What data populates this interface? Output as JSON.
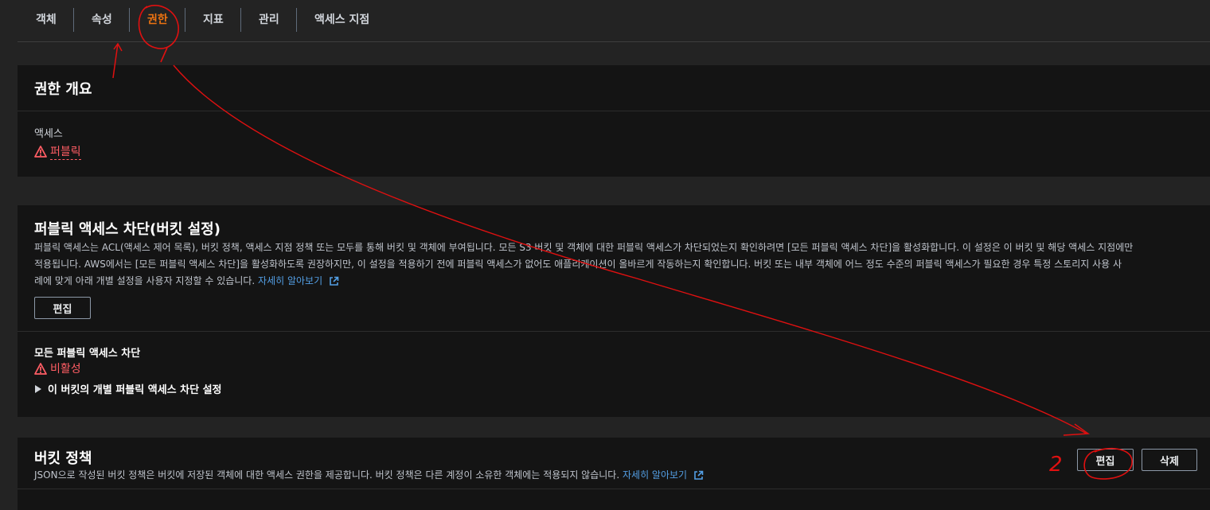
{
  "tabs": [
    {
      "label": "객체"
    },
    {
      "label": "속성"
    },
    {
      "label": "권한"
    },
    {
      "label": "지표"
    },
    {
      "label": "관리"
    },
    {
      "label": "액세스 지점"
    }
  ],
  "permissions_overview": {
    "title": "권한 개요",
    "access_label": "액세스",
    "access_value": "퍼블릭"
  },
  "block_public_access": {
    "title": "퍼블릭 액세스 차단(버킷 설정)",
    "description_line1": "퍼블릭 액세스는 ACL(액세스 제어 목록), 버킷 정책, 액세스 지점 정책 또는 모두를 통해 버킷 및 객체에 부여됩니다. 모든 S3 버킷 및 객체에 대한 퍼블릭 액세스가 차단되었는지 확인하려면 [모든 퍼블릭 액세스 차단]을 활성화합니다. 이 설정은 이 버킷 및 해당 액세스 지점에만",
    "description_line2": "적용됩니다. AWS에서는 [모든 퍼블릭 액세스 차단]을 활성화하도록 권장하지만, 이 설정을 적용하기 전에 퍼블릭 액세스가 없어도 애플리케이션이 올바르게 작동하는지 확인합니다. 버킷 또는 내부 객체에 어느 정도 수준의 퍼블릭 액세스가 필요한 경우 특정 스토리지 사용 사",
    "description_line3": "례에 맞게 아래 개별 설정을 사용자 지정할 수 있습니다.",
    "learn_more": "자세히 알아보기",
    "edit_label": "편집",
    "block_all_label": "모든 퍼블릭 액세스 차단",
    "block_all_value": "비활성",
    "expand_label": "이 버킷의 개별 퍼블릭 액세스 차단 설정"
  },
  "bucket_policy": {
    "title": "버킷 정책",
    "description": "JSON으로 작성된 버킷 정책은 버킷에 저장된 객체에 대한 액세스 권한을 제공합니다. 버킷 정책은 다른 계정이 소유한 객체에는 적용되지 않습니다.",
    "learn_more": "자세히 알아보기",
    "edit_label": "편집",
    "delete_label": "삭제"
  },
  "annotations": {
    "step_number": "2"
  },
  "colors": {
    "accent": "#ec7211",
    "warning": "#ff5d64",
    "link": "#539fe5",
    "annotation": "#e01010"
  }
}
